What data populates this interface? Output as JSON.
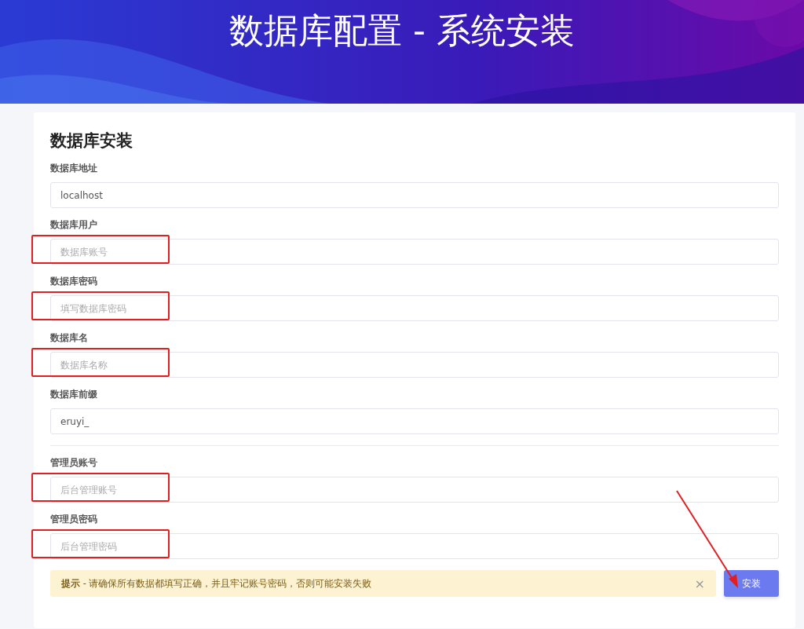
{
  "header": {
    "title": "数据库配置 - 系统安装"
  },
  "card": {
    "title": "数据库安装",
    "database_fields": [
      {
        "label": "数据库地址",
        "value": "localhost",
        "highlighted": false
      },
      {
        "label": "数据库用户",
        "placeholder": "数据库账号",
        "highlighted": true
      },
      {
        "label": "数据库密码",
        "placeholder": "填写数据库密码",
        "highlighted": true
      },
      {
        "label": "数据库名",
        "placeholder": "数据库名称",
        "highlighted": true
      },
      {
        "label": "数据库前缀",
        "value": "eruyi_",
        "highlighted": false
      }
    ],
    "admin_fields": [
      {
        "label": "管理员账号",
        "placeholder": "后台管理账号",
        "highlighted": true
      },
      {
        "label": "管理员密码",
        "placeholder": "后台管理密码",
        "highlighted": true
      }
    ],
    "alert": {
      "text": "**提示** - 请确保所有数据都填写正确，并且牢记账号密码，否则可能安装失败",
      "close": "×"
    },
    "submit_button": "安装"
  }
}
